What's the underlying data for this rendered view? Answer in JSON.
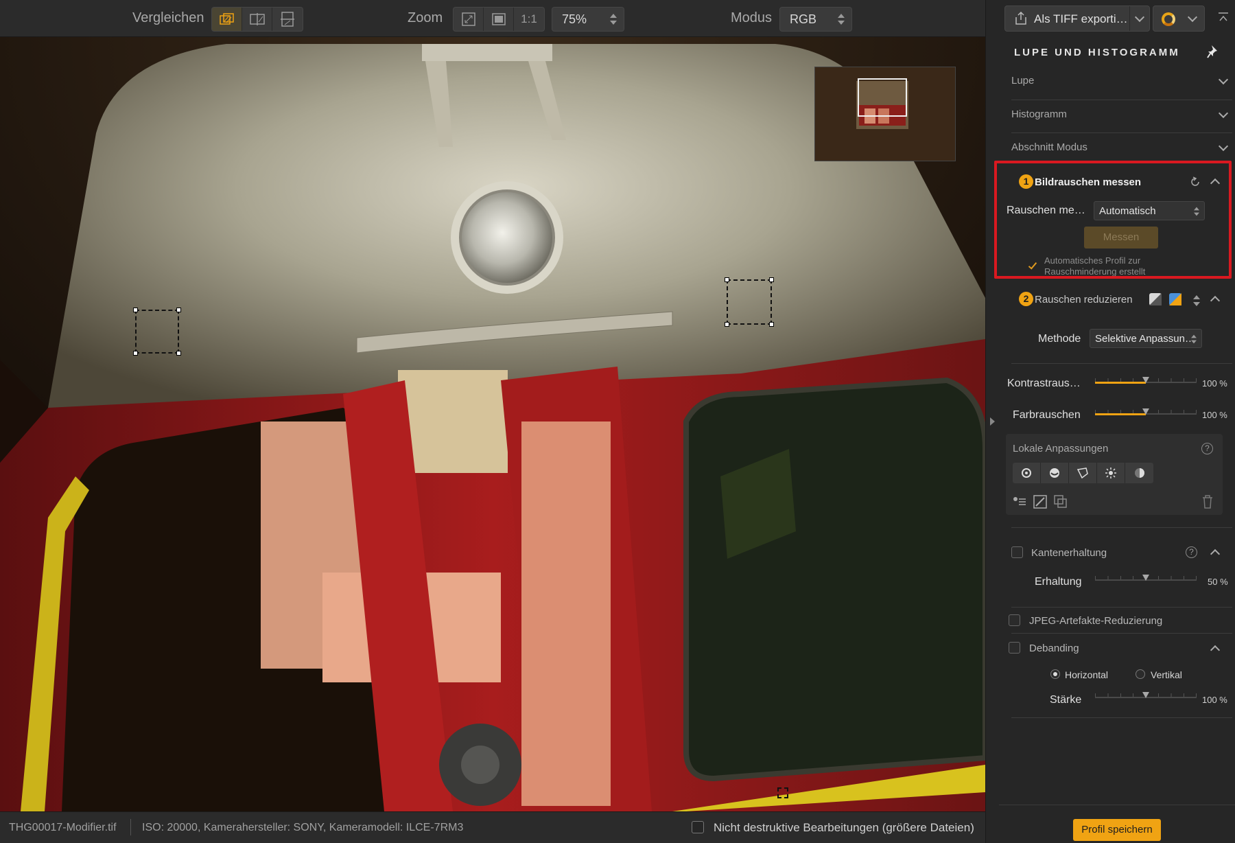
{
  "toolbar": {
    "compare_label": "Vergleichen",
    "zoom_label": "Zoom",
    "zoom_1to1": "1:1",
    "zoom_value": "75%",
    "mode_label": "Modus",
    "mode_value": "RGB"
  },
  "statusbar": {
    "filename": "THG00017-Modifier.tif",
    "exif": "ISO: 20000, Kamerahersteller: SONY, Kameramodell: ILCE-7RM3",
    "non_destructive_label": "Nicht destruktive Bearbeitungen (größere Dateien)",
    "non_destructive_checked": false
  },
  "panel": {
    "export_label": "Als TIFF exporti…",
    "title": "LUPE UND HISTOGRAMM",
    "sections": {
      "lupe": "Lupe",
      "histogramm": "Histogramm",
      "abschnitt_modus": "Abschnitt Modus"
    },
    "measure": {
      "step": "1",
      "title": "Bildrauschen messen",
      "field_label": "Rauschen me…",
      "field_value": "Automatisch",
      "button_label": "Messen",
      "note_line1": "Automatisches Profil zur",
      "note_line2": "Rauschminderung erstellt"
    },
    "reduce": {
      "step": "2",
      "title": "Rauschen reduzieren",
      "method_label": "Methode",
      "method_value": "Selektive Anpassun…",
      "contrast_label": "Kontrastraus…",
      "contrast_value": "100 %",
      "contrast_level": 0.5,
      "color_label": "Farbrauschen",
      "color_value": "100 %",
      "color_level": 0.5
    },
    "local": {
      "title": "Lokale Anpassungen"
    },
    "edge": {
      "title": "Kantenerhaltung",
      "checked": false,
      "amount_label": "Erhaltung",
      "amount_value": "50 %",
      "amount_level": 0.5
    },
    "jpeg": {
      "title": "JPEG-Artefakte-Reduzierung",
      "checked": false
    },
    "debanding": {
      "title": "Debanding",
      "checked": false,
      "horizontal_label": "Horizontal",
      "vertical_label": "Vertikal",
      "selected": "Horizontal",
      "strength_label": "Stärke",
      "strength_value": "100 %",
      "strength_level": 0.5
    },
    "save_label": "Profil speichern"
  },
  "colors": {
    "accent": "#f0a313",
    "highlight_border": "#d91920",
    "train_red": "#9e1b1b",
    "train_yellow": "#d8c21e"
  }
}
